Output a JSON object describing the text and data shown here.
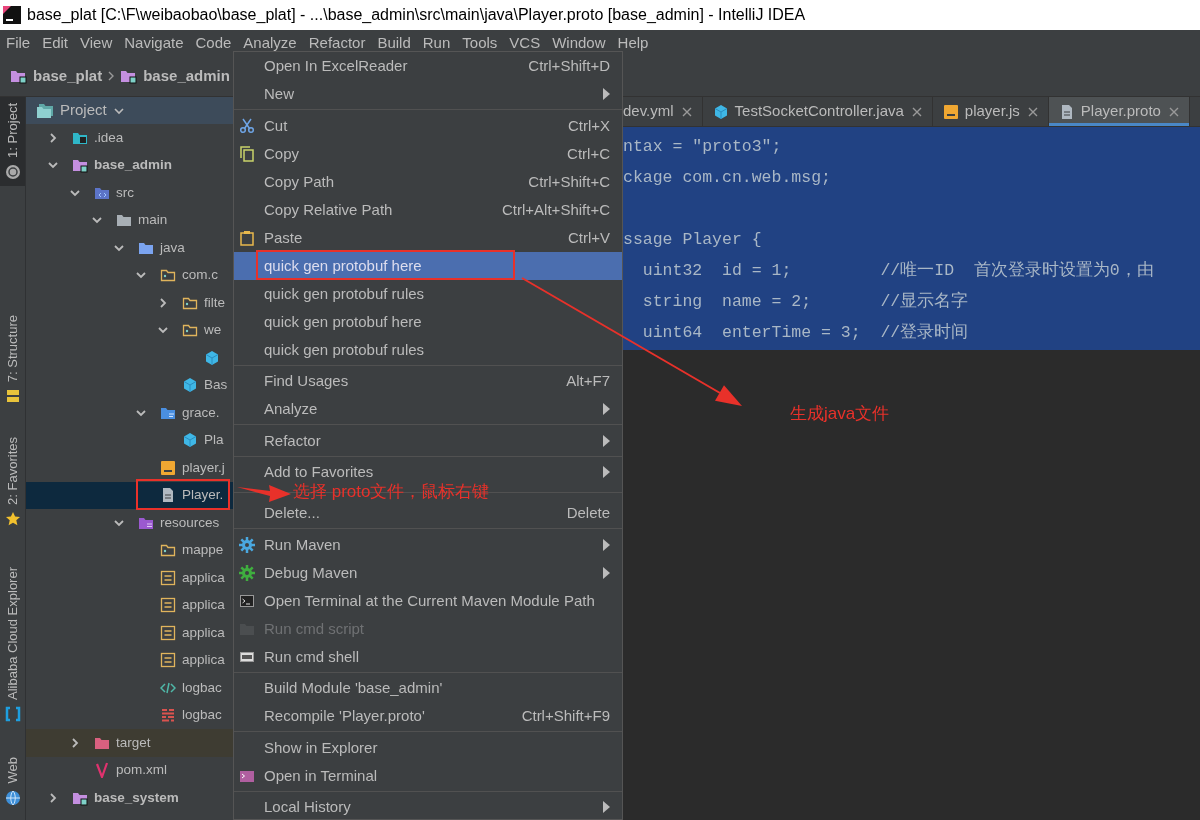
{
  "window": {
    "title": "base_plat [C:\\F\\weibaobao\\base_plat] - ...\\base_admin\\src\\main\\java\\Player.proto [base_admin] - IntelliJ IDEA"
  },
  "menu_bar": [
    "File",
    "Edit",
    "View",
    "Navigate",
    "Code",
    "Analyze",
    "Refactor",
    "Build",
    "Run",
    "Tools",
    "VCS",
    "Window",
    "Help"
  ],
  "breadcrumbs": [
    "base_plat",
    "base_admin"
  ],
  "tool_windows": [
    {
      "label": "1: Project",
      "kind": "project",
      "selected": true
    },
    {
      "label": "7: Structure",
      "kind": "structure",
      "selected": false
    },
    {
      "label": "2: Favorites",
      "kind": "favorites",
      "selected": false
    },
    {
      "label": "Alibaba Cloud Explorer",
      "kind": "cloud",
      "selected": false
    },
    {
      "label": "Web",
      "kind": "web",
      "selected": false
    }
  ],
  "project_panel": {
    "title": "Project",
    "tree": [
      {
        "label": ".idea",
        "kind": "idea-folder",
        "expanded": false,
        "selected": false
      },
      {
        "label": "base_admin",
        "kind": "module",
        "expanded": true,
        "selected": false,
        "children": [
          {
            "label": "src",
            "kind": "source-folder",
            "expanded": true,
            "selected": false,
            "children": [
              {
                "label": "main",
                "kind": "folder",
                "expanded": true,
                "selected": false,
                "children": [
                  {
                    "label": "java",
                    "kind": "java-root",
                    "expanded": true,
                    "selected": false,
                    "children": [
                      {
                        "label": "com.c",
                        "kind": "package",
                        "expanded": true,
                        "selected": false,
                        "children": [
                          {
                            "label": "filte",
                            "kind": "package",
                            "expanded": false,
                            "selected": false
                          },
                          {
                            "label": "we",
                            "kind": "package",
                            "expanded": true,
                            "selected": false,
                            "children": [
                              {
                                "kind": "class",
                                "selected": false
                              }
                            ]
                          },
                          {
                            "label": "Bas",
                            "kind": "class",
                            "selected": false
                          }
                        ]
                      },
                      {
                        "label": "grace.",
                        "kind": "proto-package",
                        "expanded": true,
                        "selected": false,
                        "children": [
                          {
                            "label": "Pla",
                            "kind": "class",
                            "selected": false
                          }
                        ]
                      },
                      {
                        "label": "player.j",
                        "kind": "js",
                        "selected": false
                      },
                      {
                        "label": "Player.",
                        "kind": "text-file",
                        "selected": true
                      }
                    ]
                  },
                  {
                    "label": "resources",
                    "kind": "resource-root",
                    "expanded": true,
                    "selected": false,
                    "children": [
                      {
                        "label": "mappe",
                        "kind": "package",
                        "selected": false
                      },
                      {
                        "label": "applica",
                        "kind": "yaml",
                        "selected": false
                      },
                      {
                        "label": "applica",
                        "kind": "yaml",
                        "selected": false
                      },
                      {
                        "label": "applica",
                        "kind": "yaml",
                        "selected": false
                      },
                      {
                        "label": "applica",
                        "kind": "yaml",
                        "selected": false
                      },
                      {
                        "label": "logbac",
                        "kind": "xml",
                        "selected": false
                      },
                      {
                        "label": "logbac",
                        "kind": "logback",
                        "selected": false
                      }
                    ]
                  }
                ]
              }
            ]
          },
          {
            "label": "target",
            "kind": "excluded-folder",
            "expanded": false,
            "selected": false
          },
          {
            "label": "pom.xml",
            "kind": "maven",
            "selected": false
          }
        ]
      },
      {
        "label": "base_system",
        "kind": "module",
        "expanded": false,
        "selected": false
      }
    ]
  },
  "editor_tabs": [
    {
      "label": "dev.yml",
      "selected": false
    },
    {
      "label": "TestSocketController.java",
      "kind": "class",
      "selected": false
    },
    {
      "label": "player.js",
      "kind": "js",
      "selected": false
    },
    {
      "label": "Player.proto",
      "kind": "text-file",
      "selected": true
    }
  ],
  "editor": {
    "selected": true,
    "code": "ntax = \"proto3\";\nckage com.cn.web.msg;\n\nssage Player {\n  uint32  id = 1;         //唯一ID  首次登录时设置为0，由\n  string  name = 2;       //显示名字\n  uint64  enterTime = 3;  //登录时间"
  },
  "context_menu": {
    "groups": [
      [
        {
          "label": "Open In ExcelReader",
          "shortcut": "Ctrl+Shift+D",
          "submenu": false,
          "selected": false,
          "disabled": false
        },
        {
          "label": "New",
          "submenu": true,
          "selected": false,
          "disabled": false
        }
      ],
      [
        {
          "label": "Cut",
          "shortcut": "Ctrl+X",
          "kind": "cut",
          "submenu": false,
          "selected": false,
          "disabled": false
        },
        {
          "label": "Copy",
          "shortcut": "Ctrl+C",
          "kind": "copy",
          "submenu": false,
          "selected": false,
          "disabled": false
        },
        {
          "label": "Copy Path",
          "shortcut": "Ctrl+Shift+C",
          "submenu": false,
          "selected": false,
          "disabled": false
        },
        {
          "label": "Copy Relative Path",
          "shortcut": "Ctrl+Alt+Shift+C",
          "submenu": false,
          "selected": false,
          "disabled": false
        },
        {
          "label": "Paste",
          "shortcut": "Ctrl+V",
          "kind": "paste",
          "submenu": false,
          "selected": false,
          "disabled": false
        },
        {
          "label": "quick gen protobuf here",
          "submenu": false,
          "selected": true,
          "disabled": false
        },
        {
          "label": "quick gen protobuf rules",
          "submenu": false,
          "selected": false,
          "disabled": false
        },
        {
          "label": "quick gen protobuf here",
          "submenu": false,
          "selected": false,
          "disabled": false
        },
        {
          "label": "quick gen protobuf rules",
          "submenu": false,
          "selected": false,
          "disabled": false
        }
      ],
      [
        {
          "label": "Find Usages",
          "shortcut": "Alt+F7",
          "submenu": false,
          "selected": false,
          "disabled": false
        },
        {
          "label": "Analyze",
          "submenu": true,
          "selected": false,
          "disabled": false
        }
      ],
      [
        {
          "label": "Refactor",
          "submenu": true,
          "selected": false,
          "disabled": false
        }
      ],
      [
        {
          "label": "Add to Favorites",
          "submenu": true,
          "selected": false,
          "disabled": false
        }
      ],
      [
        {
          "label": "Delete...",
          "shortcut": "Delete",
          "submenu": false,
          "selected": false,
          "disabled": false
        }
      ],
      [
        {
          "label": "Run Maven",
          "kind": "run-maven",
          "submenu": true,
          "selected": false,
          "disabled": false
        },
        {
          "label": "Debug Maven",
          "kind": "debug-maven",
          "submenu": true,
          "selected": false,
          "disabled": false
        },
        {
          "label": "Open Terminal at the Current Maven Module Path",
          "kind": "terminal",
          "submenu": false,
          "selected": false,
          "disabled": false
        },
        {
          "label": "Run cmd script",
          "kind": "cmd-script",
          "submenu": false,
          "selected": false,
          "disabled": true
        },
        {
          "label": "Run cmd shell",
          "kind": "cmd-shell",
          "submenu": false,
          "selected": false,
          "disabled": false
        }
      ],
      [
        {
          "label": "Build Module 'base_admin'",
          "submenu": false,
          "selected": false,
          "disabled": false
        },
        {
          "label": "Recompile 'Player.proto'",
          "shortcut": "Ctrl+Shift+F9",
          "submenu": false,
          "selected": false,
          "disabled": false
        }
      ],
      [
        {
          "label": "Show in Explorer",
          "submenu": false,
          "selected": false,
          "disabled": false
        },
        {
          "label": "Open in Terminal",
          "kind": "open-terminal",
          "submenu": false,
          "selected": false,
          "disabled": false
        }
      ],
      [
        {
          "label": "Local History",
          "submenu": true,
          "selected": false,
          "disabled": false
        }
      ]
    ]
  },
  "annotations": [
    "生成java文件",
    "选择 proto文件，鼠标右键"
  ]
}
